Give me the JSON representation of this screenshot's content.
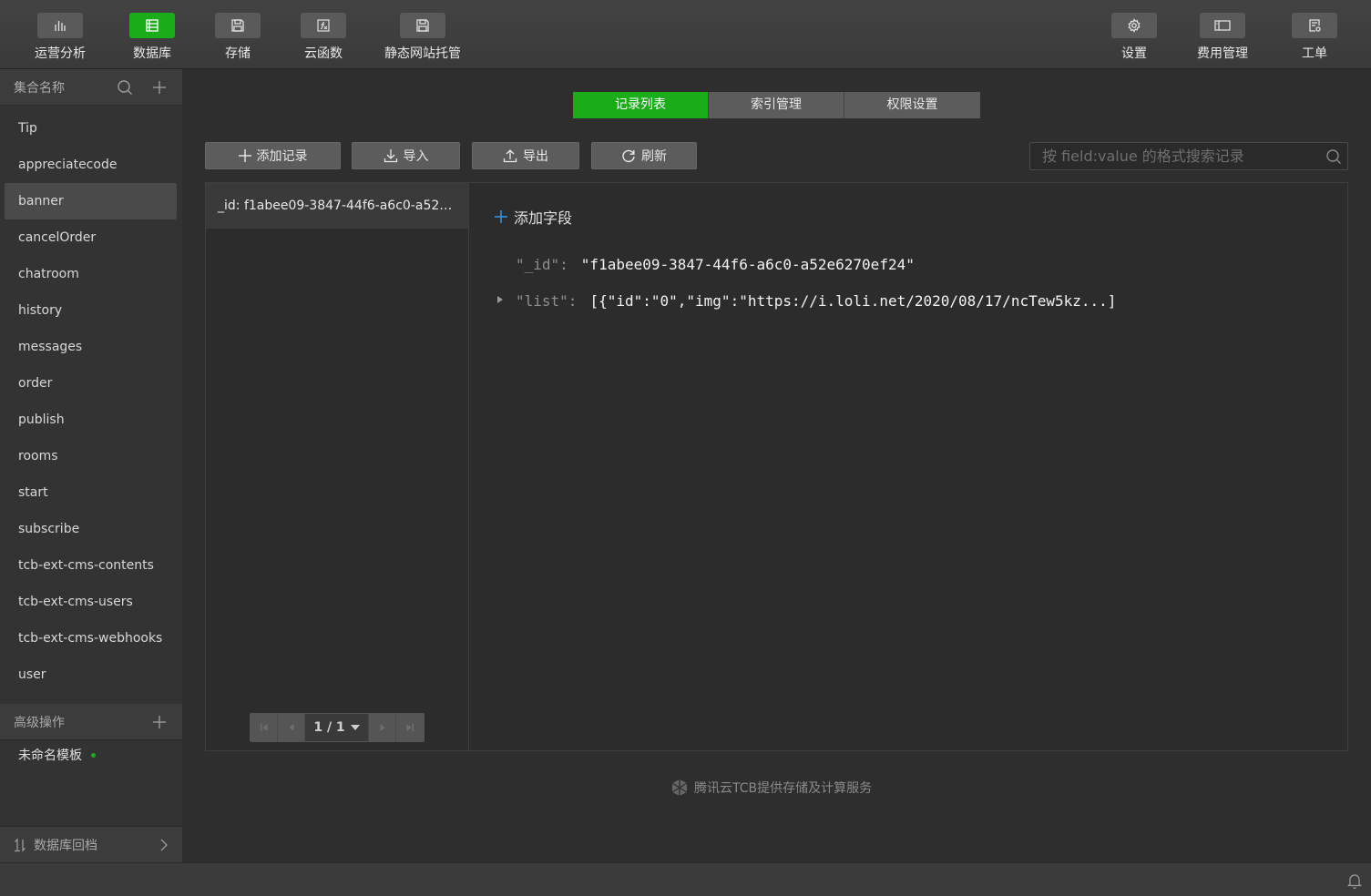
{
  "toolbar": {
    "left": [
      {
        "label": "运营分析",
        "icon": "bar-chart-icon"
      },
      {
        "label": "数据库",
        "icon": "database-icon"
      },
      {
        "label": "存储",
        "icon": "storage-icon"
      },
      {
        "label": "云函数",
        "icon": "function-icon"
      },
      {
        "label": "静态网站托管",
        "icon": "static-hosting-icon"
      }
    ],
    "right": [
      {
        "label": "设置",
        "icon": "gear-icon"
      },
      {
        "label": "费用管理",
        "icon": "billing-icon"
      },
      {
        "label": "工单",
        "icon": "ticket-icon"
      }
    ],
    "active": "数据库"
  },
  "sidebar": {
    "header": "集合名称",
    "collections": [
      "Tip",
      "appreciatecode",
      "banner",
      "cancelOrder",
      "chatroom",
      "history",
      "messages",
      "order",
      "publish",
      "rooms",
      "start",
      "subscribe",
      "tcb-ext-cms-contents",
      "tcb-ext-cms-users",
      "tcb-ext-cms-webhooks",
      "user"
    ],
    "selected": "banner",
    "advanced_header": "高级操作",
    "template": "未命名模板",
    "rollback": "数据库回档"
  },
  "tabs": [
    "记录列表",
    "索引管理",
    "权限设置"
  ],
  "active_tab": "记录列表",
  "actions": {
    "add_record": "添加记录",
    "import": "导入",
    "export": "导出",
    "refresh": "刷新"
  },
  "search": {
    "placeholder": "按 field:value 的格式搜索记录"
  },
  "records": [
    "_id: f1abee09-3847-44f6-a6c0-a52e6270ef24"
  ],
  "pager": {
    "text": "1 / 1"
  },
  "detail": {
    "add_field": "添加字段",
    "fields": [
      {
        "key": "\"_id\":",
        "value": "\"f1abee09-3847-44f6-a6c0-a52e6270ef24\""
      },
      {
        "key": "\"list\":",
        "value": "[{\"id\":\"0\",\"img\":\"https://i.loli.net/2020/08/17/ncTew5kz...]"
      }
    ]
  },
  "footer": "腾讯云TCB提供存储及计算服务",
  "colors": {
    "accent": "#1aad19",
    "background": "#2e2e2e"
  }
}
